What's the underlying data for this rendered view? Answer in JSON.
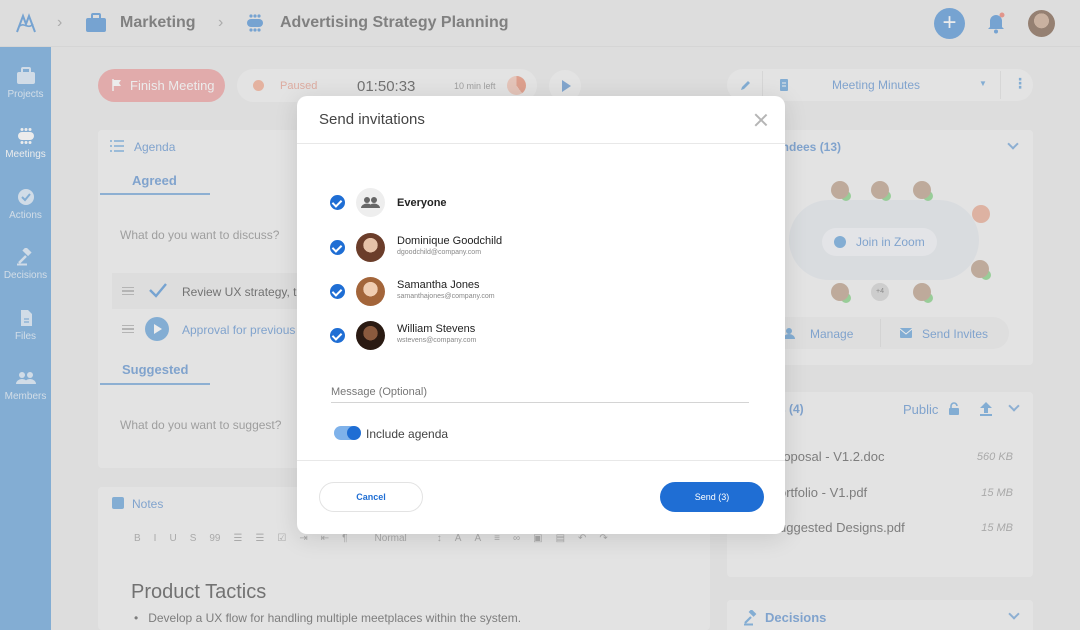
{
  "breadcrumb": {
    "section": "Marketing",
    "page": "Advertising Strategy Planning"
  },
  "sidebar": {
    "items": [
      {
        "label": "Projects"
      },
      {
        "label": "Meetings"
      },
      {
        "label": "Actions"
      },
      {
        "label": "Decisions"
      },
      {
        "label": "Files"
      },
      {
        "label": "Members"
      }
    ]
  },
  "meeting": {
    "finish_label": "Finish Meeting",
    "status": "Paused",
    "time": "01:50:33",
    "remaining": "10 min left"
  },
  "agenda": {
    "title": "Agenda",
    "tab_agreed": "Agreed",
    "discuss_placeholder": "What do you want to discuss?",
    "items": [
      "Review UX strategy, t",
      "Approval for previous"
    ],
    "tab_suggested": "Suggested",
    "suggest_placeholder": "What do you want to suggest?"
  },
  "notes": {
    "title": "Notes",
    "toolbar": [
      "B",
      "I",
      "U",
      "S",
      "99",
      "Normal"
    ],
    "heading": "Product Tactics",
    "bullet": "Develop a UX flow for handling multiple meetplaces within the system."
  },
  "right_panel": {
    "minutes_label": "Meeting Minutes",
    "attendees_title": "endees (13)",
    "zoom_label": "Join in Zoom",
    "extra_count": "+4",
    "manage_label": "Manage",
    "send_invites_label": "Send Invites",
    "files_title": "s (4)",
    "public_label": "Public",
    "files": [
      {
        "name": "roposal - V1.2.doc",
        "size": "560 KB"
      },
      {
        "name": "ortfolio - V1.pdf",
        "size": "15 MB"
      },
      {
        "name": "uggested Designs.pdf",
        "size": "15 MB"
      }
    ],
    "decisions_title": "Decisions"
  },
  "modal": {
    "title": "Send invitations",
    "invitees": [
      {
        "name": "Everyone",
        "email": ""
      },
      {
        "name": "Dominique Goodchild",
        "email": "dgoodchild@company.com"
      },
      {
        "name": "Samantha Jones",
        "email": "samanthajones@company.com"
      },
      {
        "name": "William Stevens",
        "email": "wstevens@company.com"
      }
    ],
    "message_placeholder": "Message (Optional)",
    "include_agenda_label": "Include agenda",
    "cancel_label": "Cancel",
    "send_label": "Send (3)"
  },
  "colors": {
    "accent": "#1f6ed4",
    "sidebar": "#5f9fd9",
    "finish": "#ee9b9b"
  }
}
